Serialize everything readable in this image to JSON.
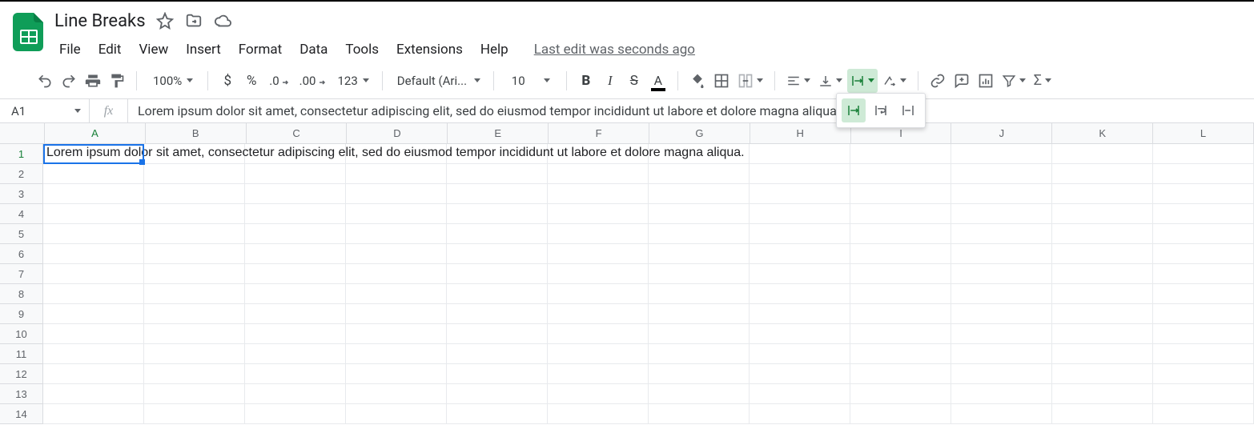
{
  "header": {
    "doc_title": "Line Breaks",
    "menus": [
      "File",
      "Edit",
      "View",
      "Insert",
      "Format",
      "Data",
      "Tools",
      "Extensions",
      "Help"
    ],
    "last_edit": "Last edit was seconds ago"
  },
  "toolbar": {
    "zoom": "100%",
    "font": "Default (Ari...",
    "font_size": "10",
    "number_format": "123",
    "currency_symbol": "$",
    "percent_symbol": "%",
    "dec_less": ".0",
    "dec_more": ".00",
    "wrap_options": [
      "overflow",
      "wrap",
      "clip"
    ],
    "wrap_selected_index": 0
  },
  "formula_bar": {
    "cell_ref": "A1",
    "fx_label": "fx",
    "formula": "Lorem ipsum dolor sit amet, consectetur adipiscing elit, sed do eiusmod tempor incididunt ut labore et dolore magna aliqua."
  },
  "grid": {
    "columns": [
      "A",
      "B",
      "C",
      "D",
      "E",
      "F",
      "G",
      "H",
      "I",
      "J",
      "K",
      "L"
    ],
    "row_count": 14,
    "selected_cell": {
      "row": 1,
      "col": "A"
    },
    "cells": {
      "A1": "Lorem ipsum dolor sit amet, consectetur adipiscing elit, sed do eiusmod tempor incididunt ut labore et dolore magna aliqua."
    }
  },
  "colors": {
    "accent": "#188038",
    "selection": "#1a73e8"
  }
}
